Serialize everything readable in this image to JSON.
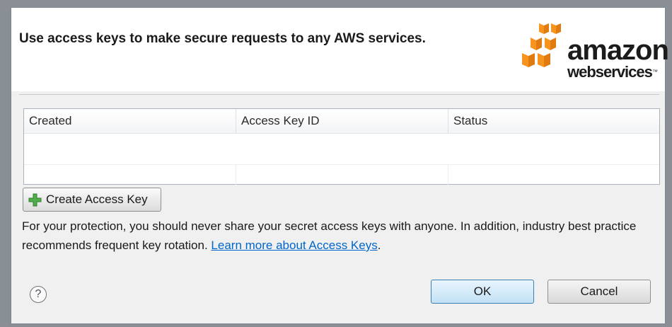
{
  "dialog": {
    "title": "Use access keys to make secure requests to any AWS services.",
    "logo": {
      "line1": "amazon",
      "line2": "webservices",
      "tm": "™"
    }
  },
  "table": {
    "columns": [
      "Created",
      "Access Key ID",
      "Status"
    ],
    "rows": []
  },
  "create_button": {
    "label": "Create Access Key",
    "icon": "plus-icon"
  },
  "info": {
    "text": "For your protection, you should never share your secret access keys with anyone.  In addition, industry best practice recommends frequent key rotation. ",
    "link": "Learn more about Access Keys",
    "after_link": "."
  },
  "help": {
    "glyph": "?",
    "icon": "help-icon"
  },
  "buttons": {
    "ok": "OK",
    "cancel": "Cancel"
  },
  "colors": {
    "accent": "#f7941d",
    "link": "#0066cc",
    "ok_border": "#3c7fb1"
  }
}
